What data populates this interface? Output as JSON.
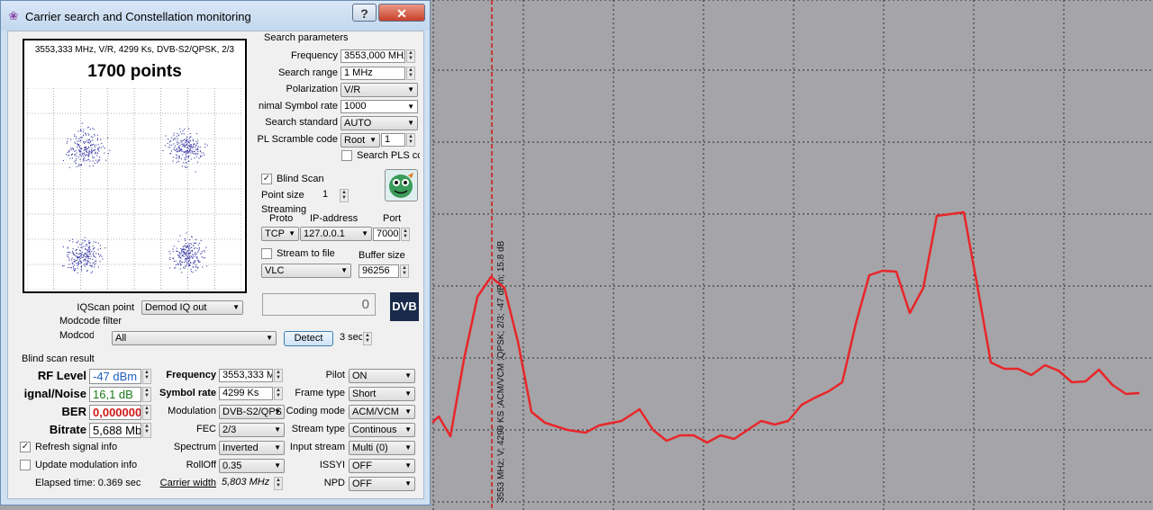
{
  "window": {
    "title": "Carrier search and Constellation monitoring",
    "help_label": "?",
    "close_label": "✕"
  },
  "constellation": {
    "info": "3553,333 MHz, V/R, 4299 Ks, DVB-S2/QPSK, 2/3",
    "points": "1700 points"
  },
  "search": {
    "header": "Search parameters",
    "frequency_label": "Frequency",
    "frequency_value": "3553,000 MHz",
    "range_label": "Search range",
    "range_value": "1 MHz",
    "polarization_label": "Polarization",
    "polarization_value": "V/R",
    "min_sr_label": "nimal Symbol rate",
    "min_sr_value": "1000",
    "standard_label": "Search standard",
    "standard_value": "AUTO",
    "pls_label": "PL Scramble code",
    "pls_mode": "Root",
    "pls_value": "1",
    "search_pls_label": "Search PLS cc"
  },
  "blind_scan": {
    "label": "Blind Scan",
    "point_size_label": "Point size",
    "point_size_value": "1"
  },
  "streaming": {
    "header": "Streaming",
    "proto_label": "Proto",
    "ip_label": "IP-address",
    "port_label": "Port",
    "proto_value": "TCP",
    "ip_value": "127.0.0.1",
    "port_value": "7000",
    "stream_file_label": "Stream to file",
    "buffer_label": "Buffer size",
    "player_value": "VLC",
    "buffer_value": "96256"
  },
  "iq": {
    "label": "IQScan point",
    "value": "Demod IQ out",
    "status_glyph": "0"
  },
  "modcode": {
    "header": "Modcode filter",
    "label": "Modcod",
    "value": "All",
    "detect_label": "Detect",
    "sec_value": "3 sec"
  },
  "dvb_logo_text": "DVB",
  "result": {
    "header": "Blind scan result",
    "rf_label": "RF Level",
    "rf_value": "-47 dBm",
    "sn_label": "ignal/Noise",
    "sn_value": "16,1 dB",
    "ber_label": "BER",
    "ber_value": "0,000000",
    "bitrate_label": "Bitrate",
    "bitrate_value": "5,688 Mb",
    "frequency_label": "Frequency",
    "frequency_value": "3553,333 M",
    "sr_label": "Symbol rate",
    "sr_value": "4299 Ks",
    "modulation_label": "Modulation",
    "modulation_value": "DVB-S2/QPS",
    "fec_label": "FEC",
    "fec_value": "2/3",
    "spectrum_label": "Spectrum",
    "spectrum_value": "Inverted",
    "rolloff_label": "RollOff",
    "rolloff_value": "0.35",
    "carrier_width_label": "Carrier width",
    "carrier_width_value": "5,803 MHz",
    "pilot_label": "Pilot",
    "pilot_value": "ON",
    "frame_label": "Frame type",
    "frame_value": "Short",
    "coding_label": "Coding mode",
    "coding_value": "ACM/VCM",
    "stream_type_label": "Stream type",
    "stream_type_value": "Continous",
    "input_stream_label": "Input stream",
    "input_stream_value": "Multi (0)",
    "issyi_label": "ISSYI",
    "issyi_value": "OFF",
    "npd_label": "NPD",
    "npd_value": "OFF",
    "refresh_label": "Refresh signal info",
    "update_label": "Update modulation info",
    "elapsed": "Elapsed time: 0.369 sec"
  },
  "spectrum": {
    "marker_text": "3553 MHz; V; 4299 KS ;ACM/VCM ;QPSK; 2/3; -47 dBm; 15.8 dB",
    "trace_color": "#e8262a",
    "marker_color": "#cc1a1a",
    "background_color": "#a5a4a8"
  },
  "colors": {
    "rf_value": "#1f5fbf",
    "sn_value": "#1a7a1a",
    "ber_value": "#d01818"
  }
}
